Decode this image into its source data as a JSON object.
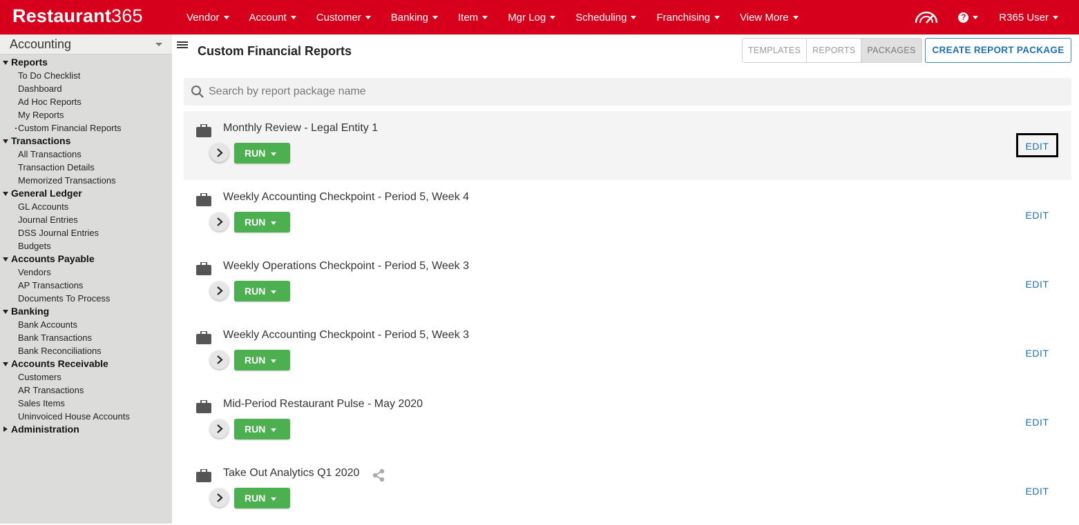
{
  "brand": {
    "name": "Restaurant",
    "number": "365"
  },
  "nav": [
    "Vendor",
    "Account",
    "Customer",
    "Banking",
    "Item",
    "Mgr Log",
    "Scheduling",
    "Franchising",
    "View More"
  ],
  "user": {
    "name": "R365 User",
    "help_glyph": "?"
  },
  "sidebar": {
    "module": "Accounting",
    "sections": [
      {
        "label": "Reports",
        "expanded": true,
        "items": [
          "To Do Checklist",
          "Dashboard",
          "Ad Hoc Reports",
          "My Reports",
          "Custom Financial Reports"
        ]
      },
      {
        "label": "Transactions",
        "expanded": true,
        "items": [
          "All Transactions",
          "Transaction Details",
          "Memorized Transactions"
        ]
      },
      {
        "label": "General Ledger",
        "expanded": true,
        "items": [
          "GL Accounts",
          "Journal Entries",
          "DSS Journal Entries",
          "Budgets"
        ]
      },
      {
        "label": "Accounts Payable",
        "expanded": true,
        "items": [
          "Vendors",
          "AP Transactions",
          "Documents To Process"
        ]
      },
      {
        "label": "Banking",
        "expanded": true,
        "items": [
          "Bank Accounts",
          "Bank Transactions",
          "Bank Reconciliations"
        ]
      },
      {
        "label": "Accounts Receivable",
        "expanded": true,
        "items": [
          "Customers",
          "AR Transactions",
          "Sales Items",
          "Uninvoiced House Accounts"
        ]
      },
      {
        "label": "Administration",
        "expanded": false,
        "items": []
      }
    ],
    "active_item": "Custom Financial Reports"
  },
  "page": {
    "title": "Custom Financial Reports",
    "tabs": [
      "TEMPLATES",
      "REPORTS",
      "PACKAGES"
    ],
    "active_tab": "PACKAGES",
    "create_label": "CREATE REPORT PACKAGE",
    "search_placeholder": "Search by report package name"
  },
  "packages": [
    {
      "name": "Monthly Review - Legal Entity 1",
      "shared": false,
      "highlight": true,
      "edit_boxed": true
    },
    {
      "name": "Weekly Accounting Checkpoint - Period 5, Week 4",
      "shared": false
    },
    {
      "name": "Weekly Operations Checkpoint - Period 5, Week 3",
      "shared": false
    },
    {
      "name": "Weekly Accounting Checkpoint - Period 5, Week 3",
      "shared": false
    },
    {
      "name": "Mid-Period Restaurant Pulse - May 2020",
      "shared": false
    },
    {
      "name": "Take Out Analytics Q1 2020",
      "shared": true
    }
  ],
  "labels": {
    "run": "RUN",
    "edit": "EDIT"
  },
  "colors": {
    "brand_red": "#d6001c",
    "run_green": "#4caf50",
    "link_blue": "#1f6fb0",
    "sidebar_bg": "#dcdddb"
  },
  "icons": {
    "search": "search-icon",
    "package": "briefcase-icon",
    "expand": "chevron-right-icon",
    "share": "share-icon",
    "help": "help-circle-icon",
    "speed": "speedometer-icon",
    "menu": "hamburger-icon"
  }
}
